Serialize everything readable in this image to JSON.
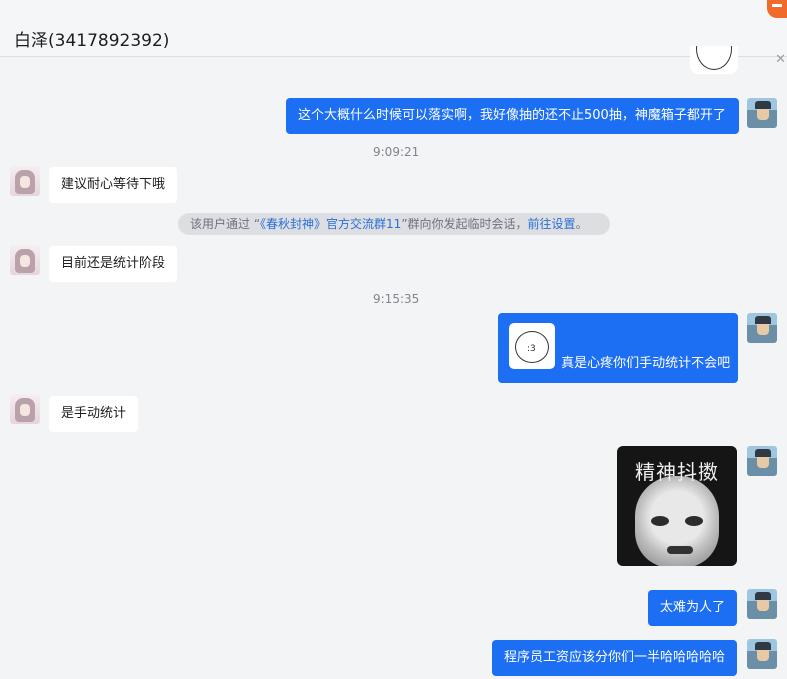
{
  "header": {
    "title": "白泽(3417892392)"
  },
  "messages": {
    "m1": "这个大概什么时候可以落实啊，我好像抽的还不止500抽，神魔箱子都开了",
    "t1": "9:09:21",
    "m2": "建议耐心等待下哦",
    "notice": {
      "prefix": "该用户通过 “",
      "group": "《春秋封神》官方交流群11",
      "middle": "”群向你发起临时会话，",
      "link": "前往设置",
      "suffix": "。"
    },
    "m3": "目前还是统计阶段",
    "t2": "9:15:35",
    "m4": "真是心疼你们手动统计不会吧",
    "m5": "是手动统计",
    "meme_caption": "精神抖擞",
    "m6": "太难为人了",
    "m7": "程序员工资应该分你们一半哈哈哈哈哈"
  },
  "icons": {
    "close": "close-icon",
    "brand": "app-logo-icon"
  },
  "colors": {
    "my_bubble": "#1c6ef2",
    "their_bubble": "#ffffff",
    "background": "#f3f4f6"
  }
}
